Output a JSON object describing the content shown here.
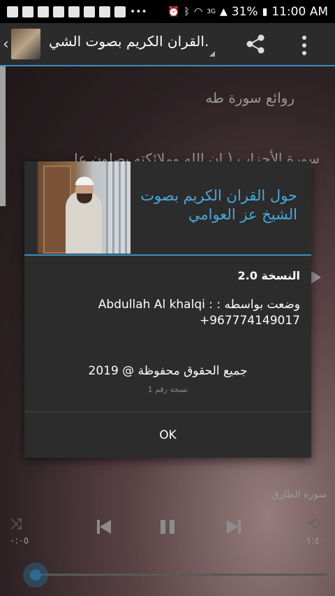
{
  "status_bar": {
    "battery": "31%",
    "time": "11:00 AM",
    "network": "3G"
  },
  "app_bar": {
    "title": "القران الكريم بصوت الشي..",
    "back_icon": "chevron-left-icon",
    "share_icon": "share-icon",
    "menu_icon": "more-vert-icon"
  },
  "list": {
    "items": [
      {
        "label": "روائع سورة طه"
      },
      {
        "label": "سورة الأحزاب ( إن الله وملائكته يصلون عل.."
      }
    ]
  },
  "player": {
    "now_playing": "سورة الطارق",
    "elapsed": "٠:٠٥",
    "duration": "١:٤٠",
    "progress_fraction": 0.05
  },
  "dialog": {
    "title": "حول القران الكريم بصوت الشيخ عز العوامي",
    "version_label": "النسخة 2.0",
    "author_line": "وضعت بواسطه : : Abdullah Al khalqi",
    "phone": "+967774149017",
    "copyright": "جميع الحقوق محفوظة @ 2019",
    "build": "نسخة رقم 1",
    "ok_label": "OK"
  },
  "colors": {
    "accent": "#3a8fc0",
    "title_blue": "#4aa8dd"
  }
}
